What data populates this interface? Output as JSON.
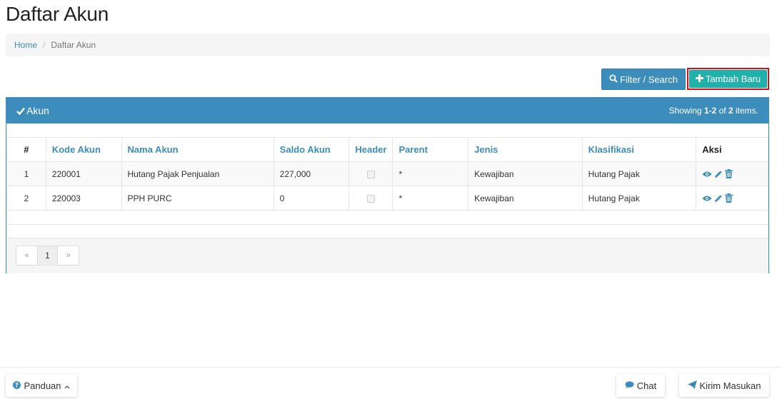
{
  "page": {
    "title": "Daftar Akun"
  },
  "breadcrumb": {
    "home": "Home",
    "separator": "/",
    "current": "Daftar Akun"
  },
  "toolbar": {
    "filter_label": "Filter / Search",
    "add_label": "Tambah Baru"
  },
  "panel": {
    "title": "Akun",
    "summary_prefix": "Showing ",
    "summary_range": "1-2",
    "summary_of": " of ",
    "summary_total": "2",
    "summary_suffix": " items."
  },
  "table": {
    "headers": [
      "#",
      "Kode Akun",
      "Nama Akun",
      "Saldo Akun",
      "Header",
      "Parent",
      "Jenis",
      "Klasifikasi",
      "Aksi"
    ],
    "rows": [
      {
        "no": "1",
        "kode": "220001",
        "nama": "Hutang Pajak Penjualan",
        "saldo": "227,000",
        "header": false,
        "parent": "*",
        "jenis": "Kewajiban",
        "klasifikasi": "Hutang Pajak"
      },
      {
        "no": "2",
        "kode": "220003",
        "nama": "PPH PURC",
        "saldo": "0",
        "header": false,
        "parent": "*",
        "jenis": "Kewajiban",
        "klasifikasi": "Hutang Pajak"
      }
    ]
  },
  "pagination": {
    "prev": "«",
    "current": "1",
    "next": "»"
  },
  "footer": {
    "panduan": "Panduan",
    "chat": "Chat",
    "kirim": "Kirim Masukan"
  },
  "colors": {
    "primary": "#3c8dbc",
    "success": "#20b2aa",
    "highlight": "#d0101a"
  },
  "icons": {
    "filter": "search-icon",
    "add": "plus-icon",
    "panel": "check-icon",
    "view": "eye-icon",
    "edit": "pencil-icon",
    "delete": "trash-icon",
    "help": "question-circle-icon",
    "chat": "comment-icon",
    "send": "paper-plane-icon"
  }
}
